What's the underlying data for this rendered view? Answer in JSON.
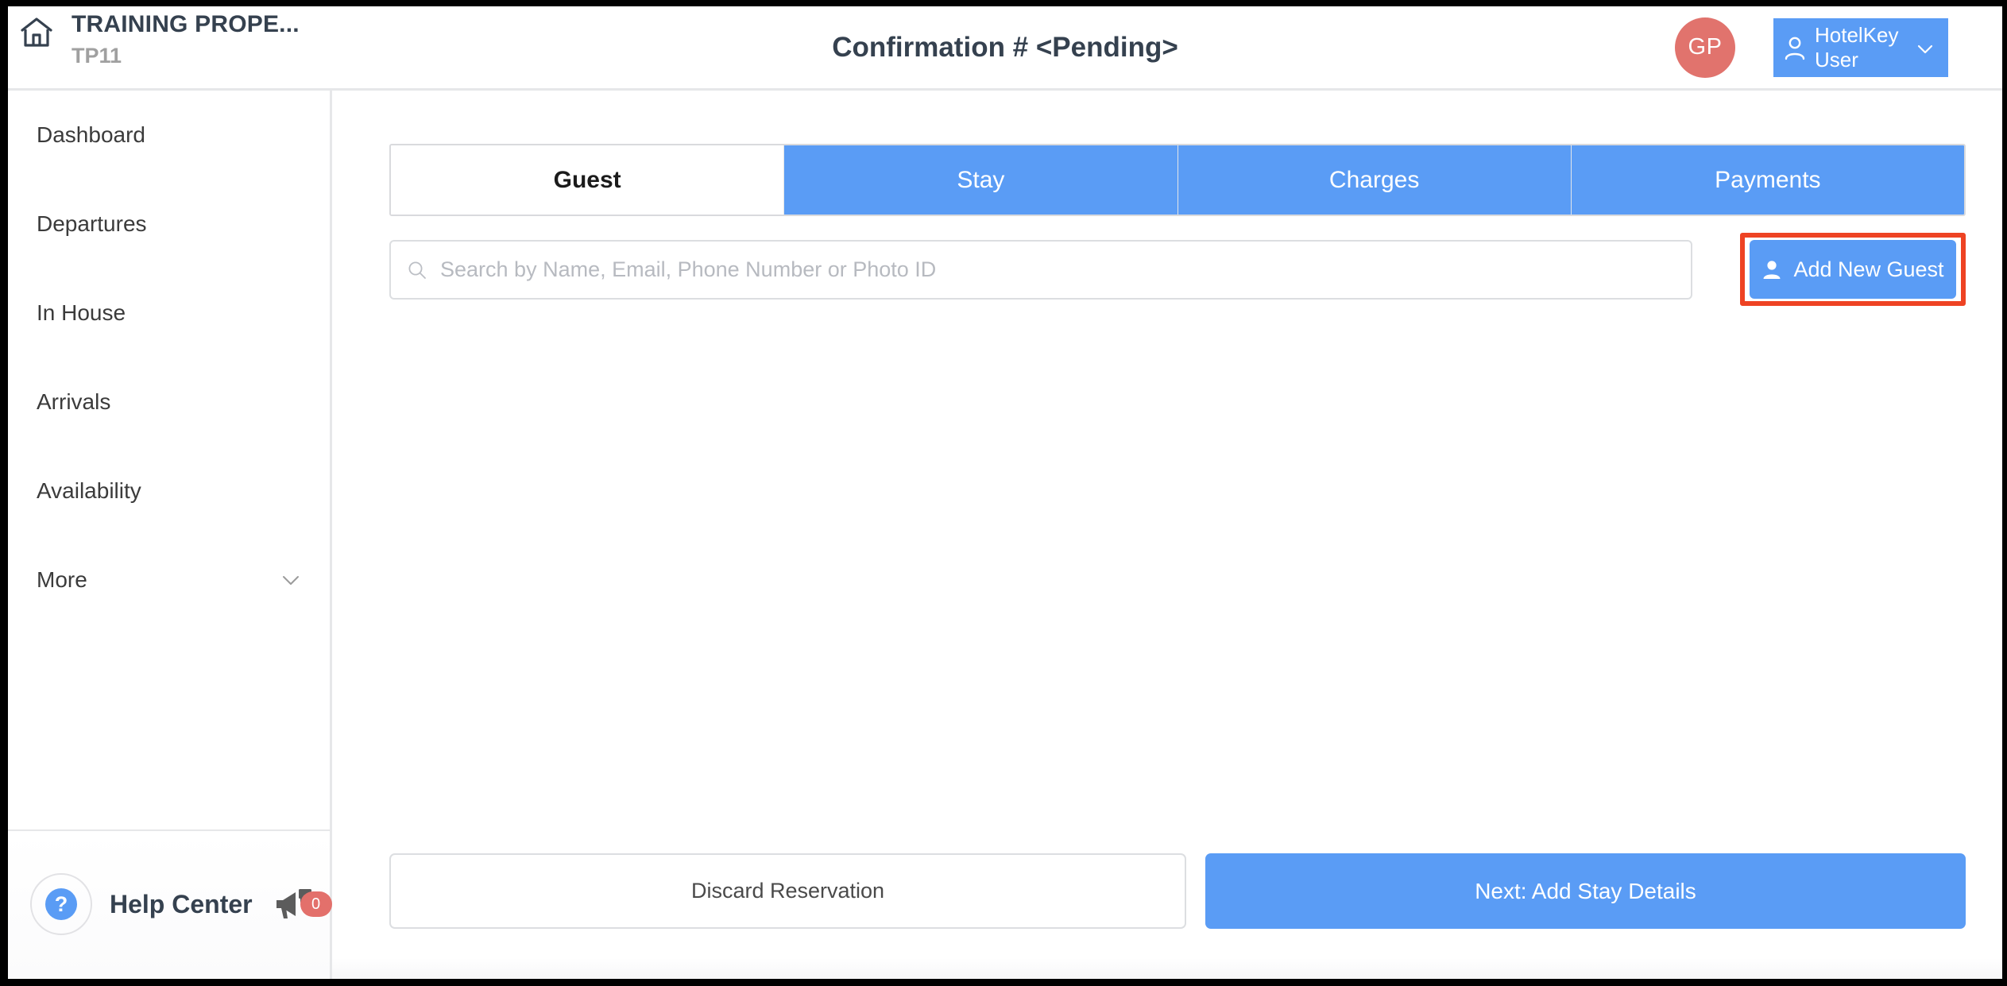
{
  "header": {
    "home_icon": "home-icon",
    "property_name": "TRAINING PROPE...",
    "property_code": "TP11",
    "title": "Confirmation # <Pending>",
    "avatar_initials": "GP",
    "avatar_color": "#e1736d",
    "user_icon": "user-outline-icon",
    "user_name": "HotelKey User",
    "user_menu_color": "#5a9cf5",
    "chevron_icon": "chevron-down-icon"
  },
  "sidebar": {
    "items": [
      {
        "label": "Dashboard",
        "has_chevron": false
      },
      {
        "label": "Departures",
        "has_chevron": false
      },
      {
        "label": "In House",
        "has_chevron": false
      },
      {
        "label": "Arrivals",
        "has_chevron": false
      },
      {
        "label": "Availability",
        "has_chevron": false
      },
      {
        "label": "More",
        "has_chevron": true
      }
    ],
    "help": {
      "question_icon": "question-mark-icon",
      "label": "Help Center",
      "megaphone_icon": "megaphone-icon",
      "badge_count": "0",
      "badge_color": "#e3706b"
    }
  },
  "main": {
    "tabs": [
      {
        "label": "Guest",
        "active": true
      },
      {
        "label": "Stay",
        "active": false
      },
      {
        "label": "Charges",
        "active": false
      },
      {
        "label": "Payments",
        "active": false
      }
    ],
    "accent_color": "#5a9cf5",
    "search": {
      "icon": "search-icon",
      "value": "",
      "placeholder": "Search by Name, Email, Phone Number or Photo ID"
    },
    "add_new_guest": {
      "label": "Add New Guest",
      "icon": "person-add-icon",
      "highlight_color": "#ee4323"
    },
    "footer": {
      "discard_label": "Discard Reservation",
      "next_label": "Next: Add Stay Details"
    }
  }
}
